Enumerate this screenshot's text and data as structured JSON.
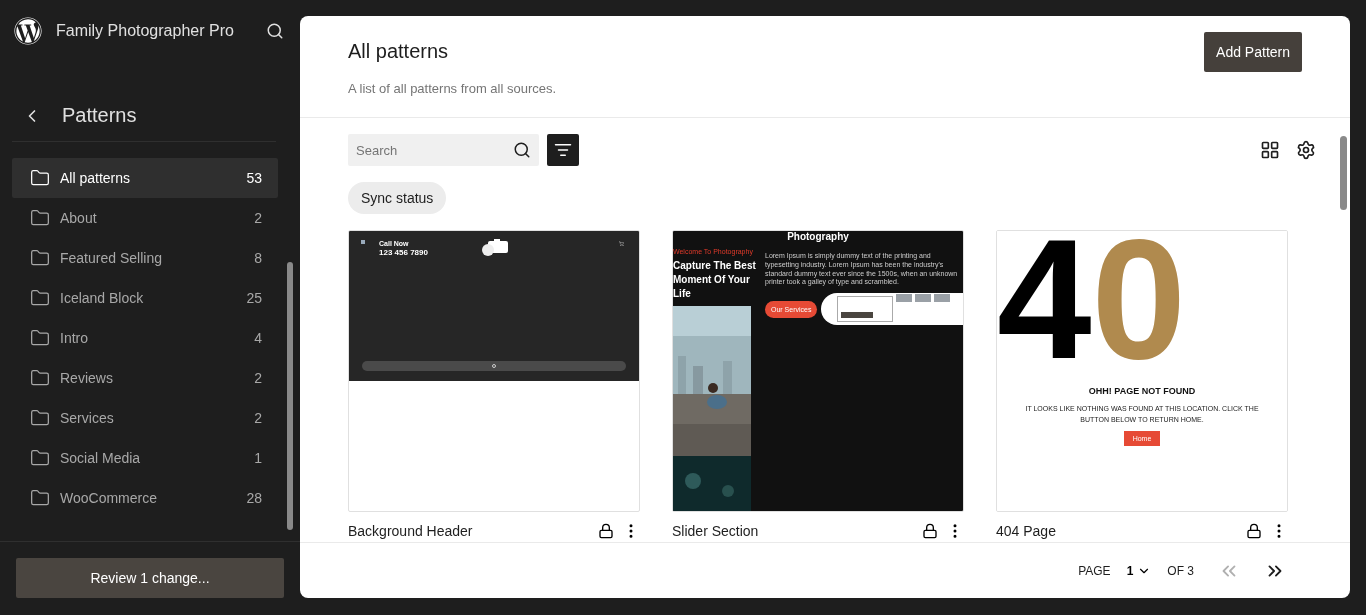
{
  "site": {
    "title": "Family Photographer Pro"
  },
  "sidebar": {
    "heading": "Patterns",
    "items": [
      {
        "label": "All patterns",
        "count": "53",
        "selected": true
      },
      {
        "label": "About",
        "count": "2",
        "selected": false
      },
      {
        "label": "Featured Selling",
        "count": "8",
        "selected": false
      },
      {
        "label": "Iceland Block",
        "count": "25",
        "selected": false
      },
      {
        "label": "Intro",
        "count": "4",
        "selected": false
      },
      {
        "label": "Reviews",
        "count": "2",
        "selected": false
      },
      {
        "label": "Services",
        "count": "2",
        "selected": false
      },
      {
        "label": "Social Media",
        "count": "1",
        "selected": false
      },
      {
        "label": "WooCommerce",
        "count": "28",
        "selected": false
      }
    ],
    "review_button": "Review 1 change..."
  },
  "header": {
    "title": "All patterns",
    "subtitle": "A list of all patterns from all sources.",
    "add_button": "Add Pattern"
  },
  "toolbar": {
    "search_placeholder": "Search",
    "sync_chip": "Sync status"
  },
  "patterns": [
    {
      "kind": "header",
      "title": "Background Header",
      "call_label": "Call Now",
      "phone": "123 456 7890"
    },
    {
      "kind": "slider",
      "title": "Slider Section",
      "top_title": "Photography",
      "welcome": "Welcome To Photography",
      "heading": "Capture The Best Moment Of Your Life",
      "body": "Lorem Ipsum is simply dummy text of the printing and typesetting industry. Lorem Ipsum has been the industry's standard dummy text ever since the 1500s, when an unknown printer took a galley of type and scrambled.",
      "button": "Our Services"
    },
    {
      "kind": "notfound",
      "title": "404 Page",
      "digits": [
        {
          "text": "4",
          "color": "#000000"
        },
        {
          "text": "0",
          "color": "#b08a4e"
        }
      ],
      "heading": "OHH! PAGE NOT FOUND",
      "body": "IT LOOKS LIKE NOTHING WAS FOUND AT THIS LOCATION. CLICK THE BUTTON BELOW TO RETURN HOME.",
      "button": "Home"
    }
  ],
  "pagination": {
    "page_label": "PAGE",
    "page": "1",
    "of_label": "OF 3"
  }
}
